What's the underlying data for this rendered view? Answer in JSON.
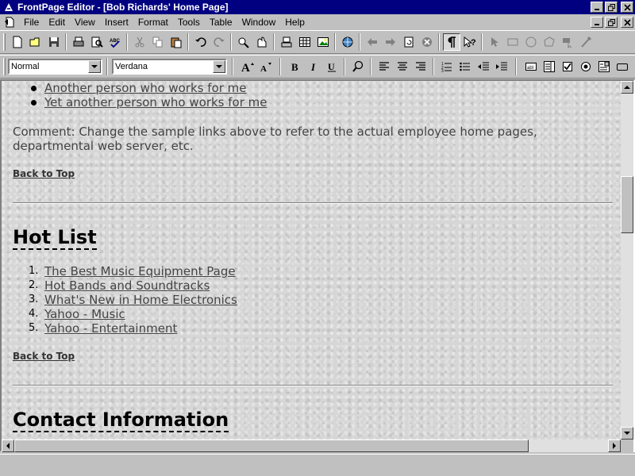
{
  "window": {
    "title": "FrontPage Editor - [Bob Richards' Home Page]"
  },
  "menu": {
    "items": [
      "File",
      "Edit",
      "View",
      "Insert",
      "Format",
      "Tools",
      "Table",
      "Window",
      "Help"
    ]
  },
  "format_toolbar": {
    "style_value": "Normal",
    "font_value": "Verdana"
  },
  "page": {
    "employee_links": [
      "Another person who works for me",
      "Yet another person who works for me"
    ],
    "comment": "Comment: Change the sample links above to refer to the actual employee home pages, departmental web server, etc.",
    "back_to_top": "Back to Top",
    "hot_list_heading": "Hot List",
    "hot_list": [
      {
        "num": "1.",
        "label": "The Best Music Equipment Page"
      },
      {
        "num": "2.",
        "label": "Hot Bands and Soundtracks"
      },
      {
        "num": "3.",
        "label": "What's New in Home Electronics"
      },
      {
        "num": "4.",
        "label": "Yahoo - Music"
      },
      {
        "num": "5.",
        "label": "Yahoo - Entertainment"
      }
    ],
    "contact_heading": "Contact Information"
  },
  "scroll": {
    "vertical_position_percent": 30,
    "horizontal_position_percent": 0
  },
  "colors": {
    "titlebar": "#000080",
    "chrome": "#c0c0c0"
  }
}
